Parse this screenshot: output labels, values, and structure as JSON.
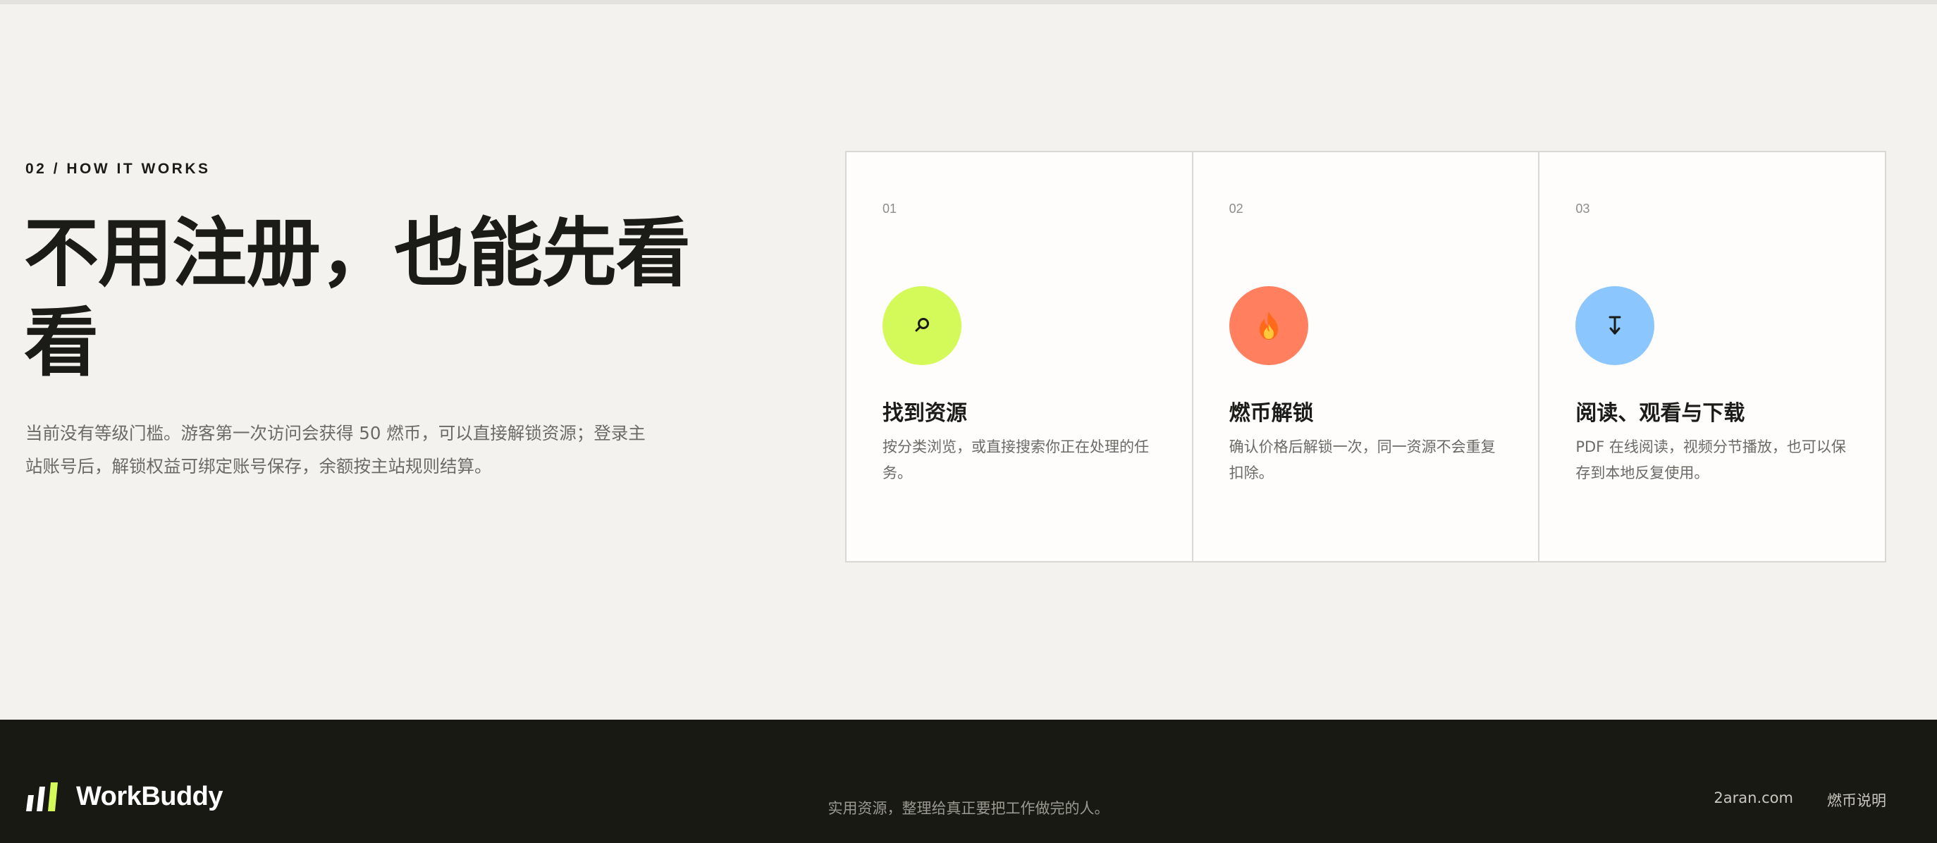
{
  "section": {
    "eyebrow": "02 / HOW IT WORKS",
    "headline": "不用注册，也能先看看",
    "lead": "当前没有等级门槛。游客第一次访问会获得 50 燃币，可以直接解锁资源；登录主站账号后，解锁权益可绑定账号保存，余额按主站规则结算。"
  },
  "steps": [
    {
      "num": "01",
      "icon": "search-icon",
      "icon_glyph": "⌕",
      "color": "#d4fa5a",
      "title": "找到资源",
      "desc": "按分类浏览，或直接搜索你正在处理的任务。"
    },
    {
      "num": "02",
      "icon": "flame-icon",
      "icon_glyph": "🔥",
      "color": "#ff7f5e",
      "title": "燃币解锁",
      "desc": "确认价格后解锁一次，同一资源不会重复扣除。"
    },
    {
      "num": "03",
      "icon": "download-icon",
      "icon_glyph": "↧",
      "color": "#8cc6ff",
      "title": "阅读、观看与下载",
      "desc": "PDF 在线阅读，视频分节播放，也可以保存到本地反复使用。"
    }
  ],
  "footer": {
    "brand": "WorkBuddy",
    "brand_colors": {
      "white": "#ffffff",
      "lime": "#d4fa5a"
    },
    "tagline": "实用资源，整理给真正要把工作做完的人。",
    "links": [
      "2aran.com",
      "燃币说明"
    ]
  }
}
